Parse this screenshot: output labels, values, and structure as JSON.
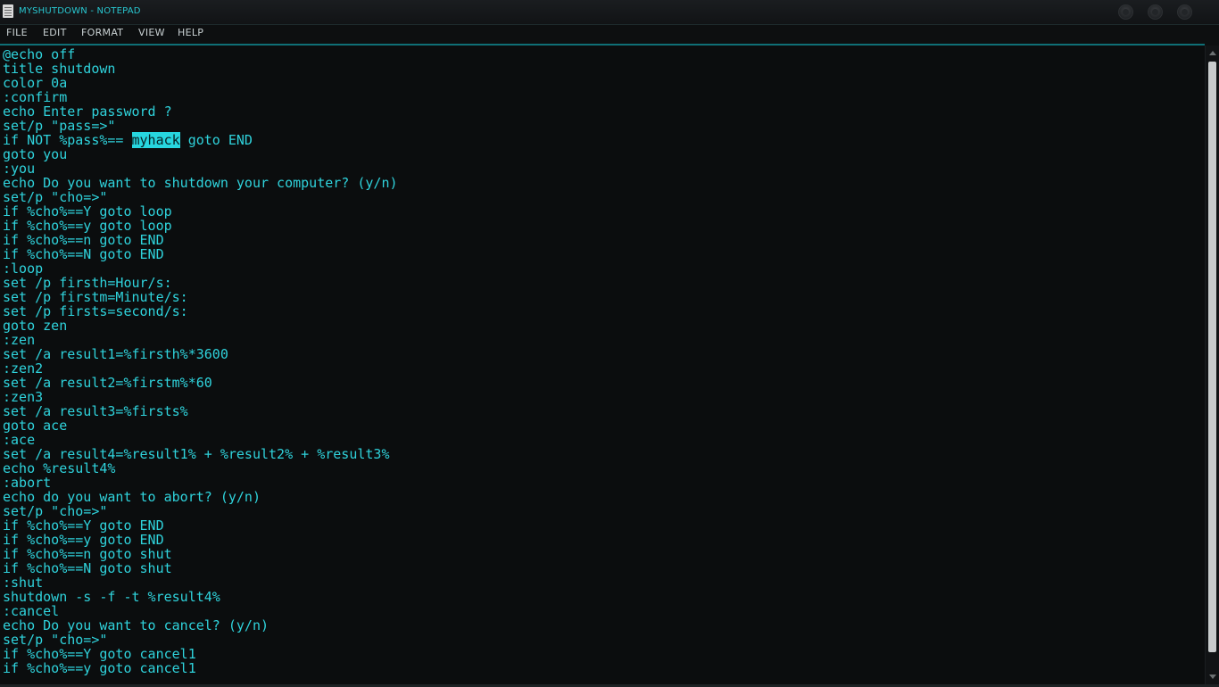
{
  "window": {
    "title": "MYSHUTDOWN - NOTEPAD"
  },
  "menu": [
    {
      "label": "FILE"
    },
    {
      "label": "EDIT"
    },
    {
      "label": "FORMAT"
    },
    {
      "label": "VIEW"
    },
    {
      "label": "HELP"
    }
  ],
  "editor": {
    "selected_text": "myhack",
    "lines": [
      "@echo off",
      "title shutdown",
      "color 0a",
      ":confirm",
      "echo Enter password ?",
      "set/p \"pass=>\"",
      "if NOT %pass%== myhack goto END",
      "goto you",
      ":you",
      "echo Do you want to shutdown your computer? (y/n)",
      "set/p \"cho=>\"",
      "if %cho%==Y goto loop",
      "if %cho%==y goto loop",
      "if %cho%==n goto END",
      "if %cho%==N goto END",
      ":loop",
      "set /p firsth=Hour/s:",
      "set /p firstm=Minute/s:",
      "set /p firsts=second/s:",
      "goto zen",
      ":zen",
      "set /a result1=%firsth%*3600",
      ":zen2",
      "set /a result2=%firstm%*60",
      ":zen3",
      "set /a result3=%firsts%",
      "goto ace",
      ":ace",
      "set /a result4=%result1% + %result2% + %result3%",
      "echo %result4%",
      ":abort",
      "echo do you want to abort? (y/n)",
      "set/p \"cho=>\"",
      "if %cho%==Y goto END",
      "if %cho%==y goto END",
      "if %cho%==n goto shut",
      "if %cho%==N goto shut",
      ":shut",
      "shutdown -s -f -t %result4%",
      ":cancel",
      "echo Do you want to cancel? (y/n)",
      "set/p \"cho=>\"",
      "if %cho%==Y goto cancel1",
      "if %cho%==y goto cancel1"
    ]
  },
  "icons": {
    "app_icon": "notepad-icon",
    "controls": [
      "minimize-icon",
      "maximize-icon",
      "close-icon"
    ]
  }
}
